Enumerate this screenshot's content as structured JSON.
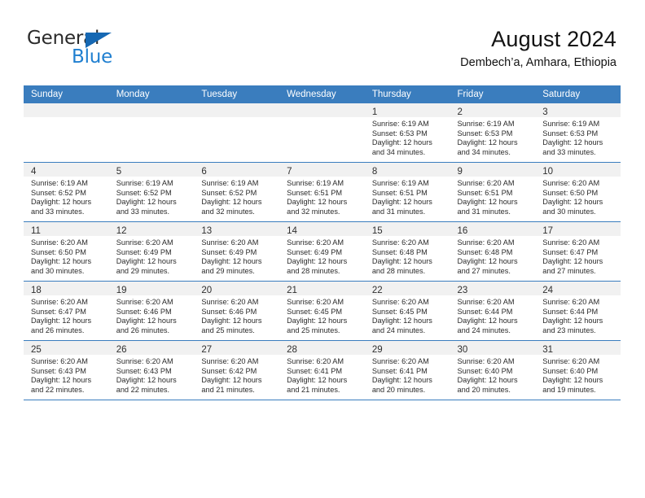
{
  "brand": {
    "name_part1": "General",
    "name_part2": "Blue",
    "accent_color": "#1f7fd0",
    "triangle_color": "#1668b3"
  },
  "header": {
    "title": "August 2024",
    "subtitle": "Dembech’a, Amhara, Ethiopia"
  },
  "calendar": {
    "header_bg": "#3a7dbe",
    "weekdays": [
      "Sunday",
      "Monday",
      "Tuesday",
      "Wednesday",
      "Thursday",
      "Friday",
      "Saturday"
    ],
    "weeks": [
      [
        {
          "day": "",
          "sunrise": "",
          "sunset": "",
          "daylight1": "",
          "daylight2": ""
        },
        {
          "day": "",
          "sunrise": "",
          "sunset": "",
          "daylight1": "",
          "daylight2": ""
        },
        {
          "day": "",
          "sunrise": "",
          "sunset": "",
          "daylight1": "",
          "daylight2": ""
        },
        {
          "day": "",
          "sunrise": "",
          "sunset": "",
          "daylight1": "",
          "daylight2": ""
        },
        {
          "day": "1",
          "sunrise": "Sunrise: 6:19 AM",
          "sunset": "Sunset: 6:53 PM",
          "daylight1": "Daylight: 12 hours",
          "daylight2": "and 34 minutes."
        },
        {
          "day": "2",
          "sunrise": "Sunrise: 6:19 AM",
          "sunset": "Sunset: 6:53 PM",
          "daylight1": "Daylight: 12 hours",
          "daylight2": "and 34 minutes."
        },
        {
          "day": "3",
          "sunrise": "Sunrise: 6:19 AM",
          "sunset": "Sunset: 6:53 PM",
          "daylight1": "Daylight: 12 hours",
          "daylight2": "and 33 minutes."
        }
      ],
      [
        {
          "day": "4",
          "sunrise": "Sunrise: 6:19 AM",
          "sunset": "Sunset: 6:52 PM",
          "daylight1": "Daylight: 12 hours",
          "daylight2": "and 33 minutes."
        },
        {
          "day": "5",
          "sunrise": "Sunrise: 6:19 AM",
          "sunset": "Sunset: 6:52 PM",
          "daylight1": "Daylight: 12 hours",
          "daylight2": "and 33 minutes."
        },
        {
          "day": "6",
          "sunrise": "Sunrise: 6:19 AM",
          "sunset": "Sunset: 6:52 PM",
          "daylight1": "Daylight: 12 hours",
          "daylight2": "and 32 minutes."
        },
        {
          "day": "7",
          "sunrise": "Sunrise: 6:19 AM",
          "sunset": "Sunset: 6:51 PM",
          "daylight1": "Daylight: 12 hours",
          "daylight2": "and 32 minutes."
        },
        {
          "day": "8",
          "sunrise": "Sunrise: 6:19 AM",
          "sunset": "Sunset: 6:51 PM",
          "daylight1": "Daylight: 12 hours",
          "daylight2": "and 31 minutes."
        },
        {
          "day": "9",
          "sunrise": "Sunrise: 6:20 AM",
          "sunset": "Sunset: 6:51 PM",
          "daylight1": "Daylight: 12 hours",
          "daylight2": "and 31 minutes."
        },
        {
          "day": "10",
          "sunrise": "Sunrise: 6:20 AM",
          "sunset": "Sunset: 6:50 PM",
          "daylight1": "Daylight: 12 hours",
          "daylight2": "and 30 minutes."
        }
      ],
      [
        {
          "day": "11",
          "sunrise": "Sunrise: 6:20 AM",
          "sunset": "Sunset: 6:50 PM",
          "daylight1": "Daylight: 12 hours",
          "daylight2": "and 30 minutes."
        },
        {
          "day": "12",
          "sunrise": "Sunrise: 6:20 AM",
          "sunset": "Sunset: 6:49 PM",
          "daylight1": "Daylight: 12 hours",
          "daylight2": "and 29 minutes."
        },
        {
          "day": "13",
          "sunrise": "Sunrise: 6:20 AM",
          "sunset": "Sunset: 6:49 PM",
          "daylight1": "Daylight: 12 hours",
          "daylight2": "and 29 minutes."
        },
        {
          "day": "14",
          "sunrise": "Sunrise: 6:20 AM",
          "sunset": "Sunset: 6:49 PM",
          "daylight1": "Daylight: 12 hours",
          "daylight2": "and 28 minutes."
        },
        {
          "day": "15",
          "sunrise": "Sunrise: 6:20 AM",
          "sunset": "Sunset: 6:48 PM",
          "daylight1": "Daylight: 12 hours",
          "daylight2": "and 28 minutes."
        },
        {
          "day": "16",
          "sunrise": "Sunrise: 6:20 AM",
          "sunset": "Sunset: 6:48 PM",
          "daylight1": "Daylight: 12 hours",
          "daylight2": "and 27 minutes."
        },
        {
          "day": "17",
          "sunrise": "Sunrise: 6:20 AM",
          "sunset": "Sunset: 6:47 PM",
          "daylight1": "Daylight: 12 hours",
          "daylight2": "and 27 minutes."
        }
      ],
      [
        {
          "day": "18",
          "sunrise": "Sunrise: 6:20 AM",
          "sunset": "Sunset: 6:47 PM",
          "daylight1": "Daylight: 12 hours",
          "daylight2": "and 26 minutes."
        },
        {
          "day": "19",
          "sunrise": "Sunrise: 6:20 AM",
          "sunset": "Sunset: 6:46 PM",
          "daylight1": "Daylight: 12 hours",
          "daylight2": "and 26 minutes."
        },
        {
          "day": "20",
          "sunrise": "Sunrise: 6:20 AM",
          "sunset": "Sunset: 6:46 PM",
          "daylight1": "Daylight: 12 hours",
          "daylight2": "and 25 minutes."
        },
        {
          "day": "21",
          "sunrise": "Sunrise: 6:20 AM",
          "sunset": "Sunset: 6:45 PM",
          "daylight1": "Daylight: 12 hours",
          "daylight2": "and 25 minutes."
        },
        {
          "day": "22",
          "sunrise": "Sunrise: 6:20 AM",
          "sunset": "Sunset: 6:45 PM",
          "daylight1": "Daylight: 12 hours",
          "daylight2": "and 24 minutes."
        },
        {
          "day": "23",
          "sunrise": "Sunrise: 6:20 AM",
          "sunset": "Sunset: 6:44 PM",
          "daylight1": "Daylight: 12 hours",
          "daylight2": "and 24 minutes."
        },
        {
          "day": "24",
          "sunrise": "Sunrise: 6:20 AM",
          "sunset": "Sunset: 6:44 PM",
          "daylight1": "Daylight: 12 hours",
          "daylight2": "and 23 minutes."
        }
      ],
      [
        {
          "day": "25",
          "sunrise": "Sunrise: 6:20 AM",
          "sunset": "Sunset: 6:43 PM",
          "daylight1": "Daylight: 12 hours",
          "daylight2": "and 22 minutes."
        },
        {
          "day": "26",
          "sunrise": "Sunrise: 6:20 AM",
          "sunset": "Sunset: 6:43 PM",
          "daylight1": "Daylight: 12 hours",
          "daylight2": "and 22 minutes."
        },
        {
          "day": "27",
          "sunrise": "Sunrise: 6:20 AM",
          "sunset": "Sunset: 6:42 PM",
          "daylight1": "Daylight: 12 hours",
          "daylight2": "and 21 minutes."
        },
        {
          "day": "28",
          "sunrise": "Sunrise: 6:20 AM",
          "sunset": "Sunset: 6:41 PM",
          "daylight1": "Daylight: 12 hours",
          "daylight2": "and 21 minutes."
        },
        {
          "day": "29",
          "sunrise": "Sunrise: 6:20 AM",
          "sunset": "Sunset: 6:41 PM",
          "daylight1": "Daylight: 12 hours",
          "daylight2": "and 20 minutes."
        },
        {
          "day": "30",
          "sunrise": "Sunrise: 6:20 AM",
          "sunset": "Sunset: 6:40 PM",
          "daylight1": "Daylight: 12 hours",
          "daylight2": "and 20 minutes."
        },
        {
          "day": "31",
          "sunrise": "Sunrise: 6:20 AM",
          "sunset": "Sunset: 6:40 PM",
          "daylight1": "Daylight: 12 hours",
          "daylight2": "and 19 minutes."
        }
      ]
    ]
  }
}
